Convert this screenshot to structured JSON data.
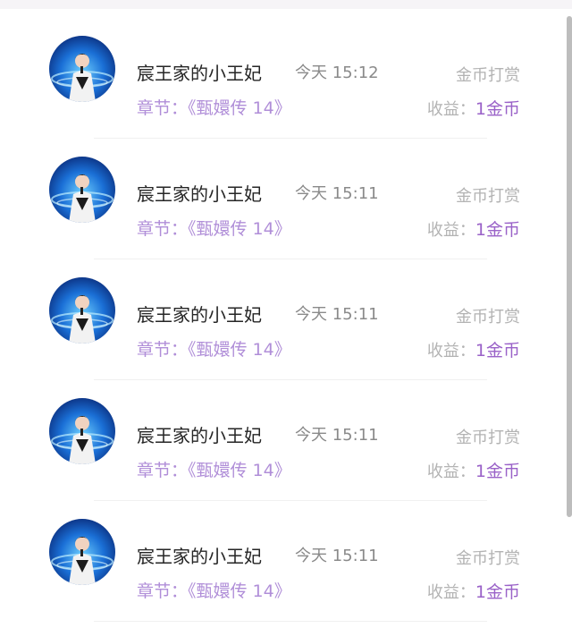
{
  "list": {
    "items": [
      {
        "user": "宸王家的小王妃",
        "time": "今天 15:12",
        "type": "金币打赏",
        "chapter_label": "章节：",
        "chapter": "《甄嬛传 14》",
        "earn_label": "收益：",
        "earn_value": "1金币"
      },
      {
        "user": "宸王家的小王妃",
        "time": "今天 15:11",
        "type": "金币打赏",
        "chapter_label": "章节：",
        "chapter": "《甄嬛传 14》",
        "earn_label": "收益：",
        "earn_value": "1金币"
      },
      {
        "user": "宸王家的小王妃",
        "time": "今天 15:11",
        "type": "金币打赏",
        "chapter_label": "章节：",
        "chapter": "《甄嬛传 14》",
        "earn_label": "收益：",
        "earn_value": "1金币"
      },
      {
        "user": "宸王家的小王妃",
        "time": "今天 15:11",
        "type": "金币打赏",
        "chapter_label": "章节：",
        "chapter": "《甄嬛传 14》",
        "earn_label": "收益：",
        "earn_value": "1金币"
      },
      {
        "user": "宸王家的小王妃",
        "time": "今天 15:11",
        "type": "金币打赏",
        "chapter_label": "章节：",
        "chapter": "《甄嬛传 14》",
        "earn_label": "收益：",
        "earn_value": "1金币"
      }
    ]
  },
  "colors": {
    "accent": "#b08ed8",
    "accent_strong": "#9a62c8",
    "muted": "#b3b3b3"
  }
}
